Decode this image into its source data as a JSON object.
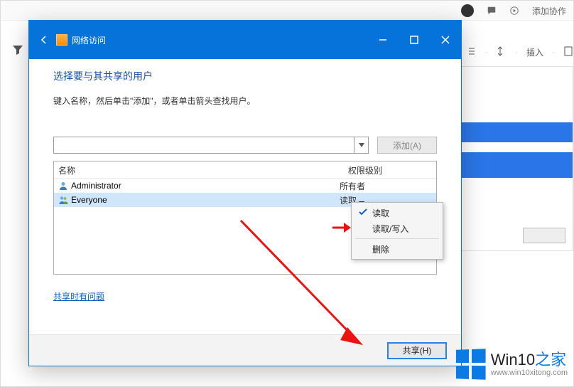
{
  "background": {
    "top_add_action": "添加协作",
    "right_tool_insert": "插入"
  },
  "dialog": {
    "title": "网络访问",
    "heading": "选择要与其共享的用户",
    "subtext": "键入名称，然后单击\"添加\"，或者单击箭头查找用户。",
    "add_button": "添加(A)",
    "columns": {
      "name": "名称",
      "perm": "权限级别"
    },
    "rows": [
      {
        "name": "Administrator",
        "perm": "所有者",
        "selected": false
      },
      {
        "name": "Everyone",
        "perm": "读取",
        "selected": true,
        "has_caret": true
      }
    ],
    "trouble_link": "共享时有问题",
    "share_button": "共享(H)"
  },
  "menu": {
    "items": [
      {
        "label": "读取",
        "checked": true
      },
      {
        "label": "读取/写入",
        "checked": false
      }
    ],
    "delete": "删除"
  },
  "watermark": {
    "title_a": "Win10",
    "title_b": "之家",
    "url": "www.win10xitong.com"
  }
}
